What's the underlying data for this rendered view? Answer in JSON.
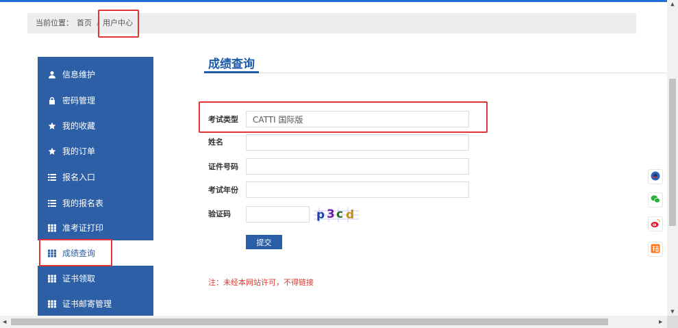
{
  "breadcrumb": {
    "label": "当前位置：",
    "home": "首页",
    "separator": "/",
    "current": "用户中心"
  },
  "sidebar": {
    "items": [
      {
        "label": "信息维护",
        "icon": "user-icon"
      },
      {
        "label": "密码管理",
        "icon": "lock-icon"
      },
      {
        "label": "我的收藏",
        "icon": "star-icon"
      },
      {
        "label": "我的订单",
        "icon": "star-icon"
      },
      {
        "label": "报名入口",
        "icon": "list-icon"
      },
      {
        "label": "我的报名表",
        "icon": "list-icon"
      },
      {
        "label": "准考证打印",
        "icon": "grid-icon"
      },
      {
        "label": "成绩查询",
        "icon": "grid-icon",
        "active": true
      },
      {
        "label": "证书领取",
        "icon": "grid-icon"
      },
      {
        "label": "证书邮寄管理",
        "icon": "grid-icon"
      }
    ]
  },
  "main": {
    "title": "成绩查询",
    "form": {
      "exam_type_label": "考试类型",
      "exam_type_value": "CATTI 国际版",
      "name_label": "姓名",
      "name_value": "",
      "id_label": "证件号码",
      "id_value": "",
      "year_label": "考试年份",
      "year_value": "",
      "captcha_label": "验证码",
      "captcha_value": "",
      "captcha_image_text": "p3cd",
      "submit_label": "提交"
    },
    "note": "注：未经本网站许可，不得链接"
  },
  "float_buttons": [
    "qq-icon",
    "wechat-icon",
    "weibo-icon",
    "taobao-icon"
  ],
  "colors": {
    "sidebar_bg": "#2c5fa6",
    "accent": "#1d5ba8",
    "highlight": "#e23333",
    "note": "#e0372e"
  }
}
